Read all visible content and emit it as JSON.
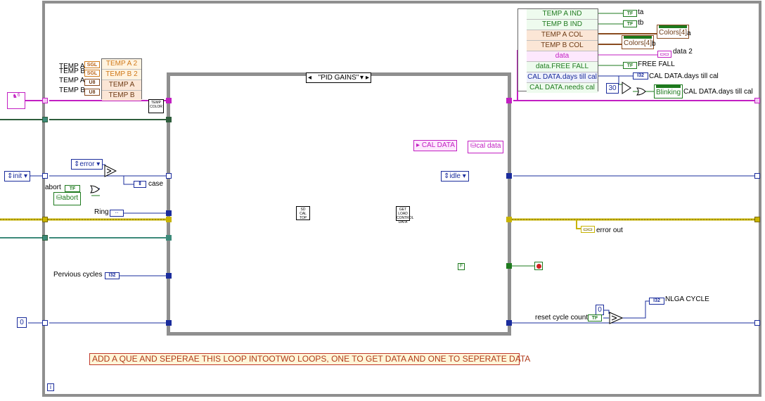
{
  "colors": {
    "error_wire": "#c8b400",
    "cluster_wire": "#c21fc2",
    "enum_wire": "#1a2c9c",
    "numeric_wire": "#1a2c9c",
    "bool_wire": "#1e7a1e",
    "loop_border": "#8f8f8f"
  },
  "case_selector": "\"PID GAINS\"",
  "left_controls": {
    "temp_a2_label": "TEMP A",
    "temp_b2_label": "TEMP B",
    "temp_a_label": "TEMP A",
    "temp_b_label": "TEMP B",
    "bundle_temp_a2": "TEMP A 2",
    "bundle_temp_b2": "TEMP B 2",
    "bundle_temp_a": "TEMP A",
    "bundle_temp_b": "TEMP B",
    "temp_color_subvi": "TEMP COLOR",
    "constant_6": "6",
    "init_enum": "init",
    "error_enum": "error",
    "abort_label": "abort",
    "abort_indicator": "abort",
    "abort_tf": "TF",
    "case_label": "case",
    "ring_label": "Ring",
    "pervious_cycles_label": "Pervious cycles",
    "i32_terminal": "I32",
    "zero_constant": "0"
  },
  "inner_case": {
    "sd_cal_top_subvi": "SD CAL TOP",
    "get_load_control_data_subvi": "GET LOAD CONTROL DATA",
    "cal_data_unbundle": "CAL DATA",
    "cal_data_indicator": "cal data",
    "idle_enum": "idle",
    "false_constant": "F"
  },
  "right_unbundle": {
    "rows": [
      "TEMP A IND",
      "TEMP B IND",
      "TEMP A COL",
      "TEMP B COL",
      "data",
      "data.FREE FALL",
      "CAL DATA.days till cal",
      "CAL DATA.needs cal"
    ],
    "ta_label": "ta",
    "tb_label": "tb",
    "colors_a_term": "Colors[4]",
    "colors_a_label": "a",
    "colors_b_term": "Colors[4]",
    "colors_b_label": "b",
    "data2_label": "data 2",
    "free_fall_label": "FREE FALL",
    "days_till_cal_label": "CAL DATA.days till cal",
    "thirty_constant": "30",
    "blinking_label": "Blinking",
    "days_till_cal_label2": "CAL DATA.days till cal",
    "error_out_label": "error out",
    "reset_cycle_count_label": "reset cycle count",
    "nlga_cycle_label": "NLGA CYCLE",
    "zero_constant_right": "0",
    "tf_term": "TF"
  },
  "comment": "ADD A QUE AND SEPERAE THIS LOOP INTOOTWO LOOPS, ONE TO GET DATA AND ONE TO SEPERATE DATA",
  "loop_info_terminal": "i"
}
